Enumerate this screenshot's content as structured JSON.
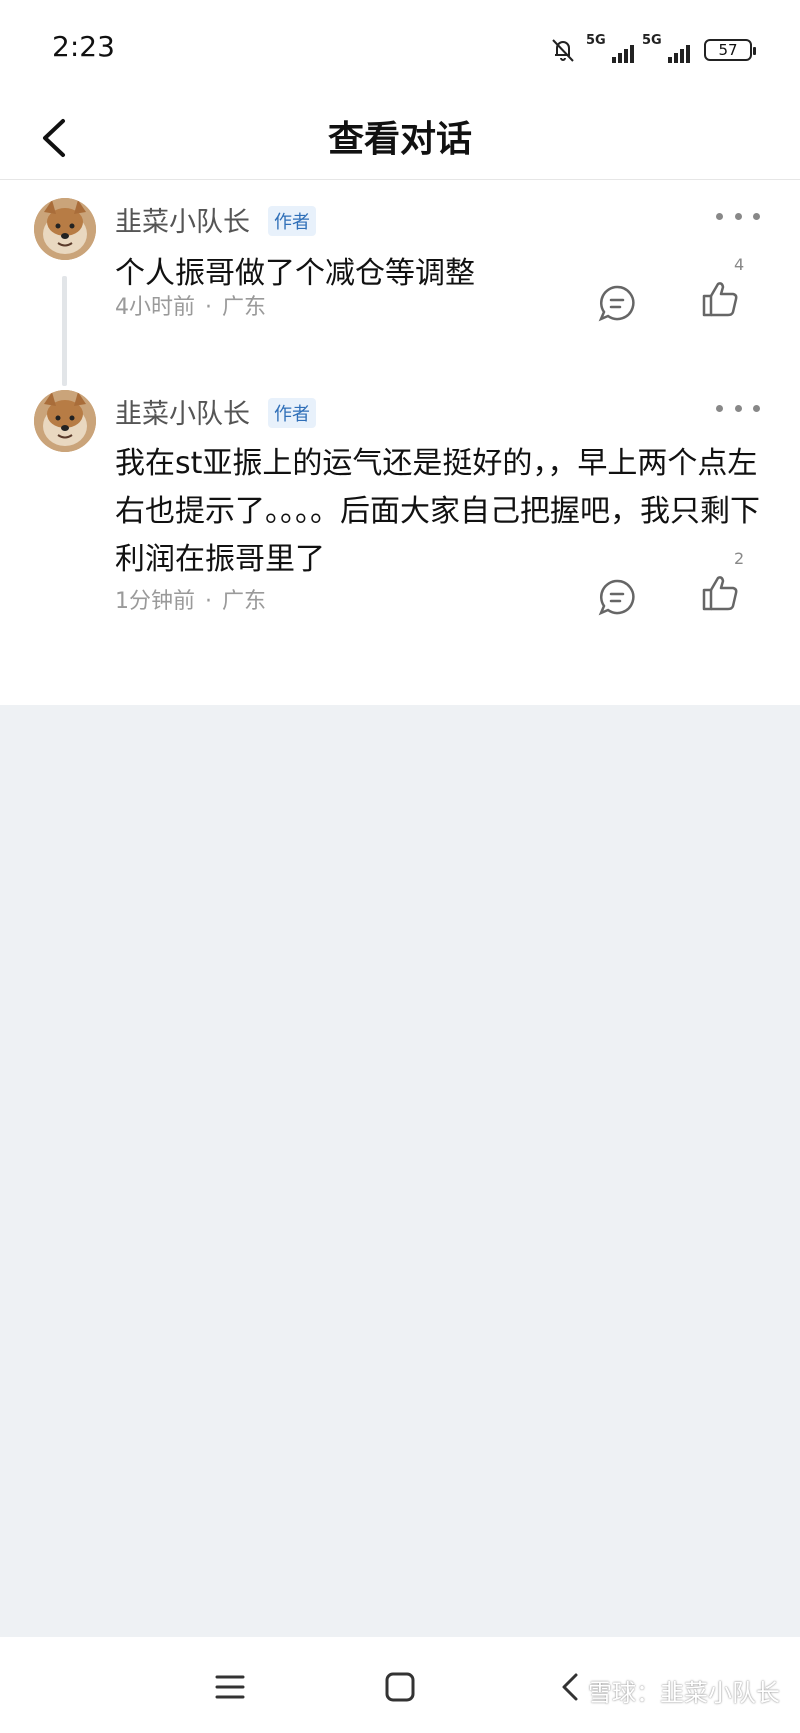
{
  "status_bar": {
    "time": "2:23",
    "signal_1_label": "5G",
    "signal_2_label": "5G",
    "battery": "57",
    "icons": [
      "mute-bell-icon",
      "signal-icon",
      "signal-icon",
      "battery-icon"
    ]
  },
  "header": {
    "title": "查看对话",
    "back_icon": "chevron-left-icon"
  },
  "comments": [
    {
      "username": "韭菜小队长",
      "badge": "作者",
      "text": "个人振哥做了个减仓等调整",
      "time": "4小时前",
      "location": "广东",
      "separator": "·",
      "likes": "4"
    },
    {
      "username": "韭菜小队长",
      "badge": "作者",
      "text": "我在st亚振上的运气还是挺好的，，早上两个点左右也提示了。。。。后面大家自己把握吧，我只剩下利润在振哥里了",
      "time": "1分钟前",
      "location": "广东",
      "separator": "·",
      "likes": "2"
    }
  ],
  "nav_bar": {
    "icons": [
      "menu-icon",
      "home-square-icon",
      "back-chevron-icon"
    ]
  },
  "watermark": {
    "text": "雪球：韭菜小队长"
  },
  "colors": {
    "badge_text": "#2f6fb8",
    "badge_bg": "#e8f1fb",
    "background": "#eef1f4"
  }
}
